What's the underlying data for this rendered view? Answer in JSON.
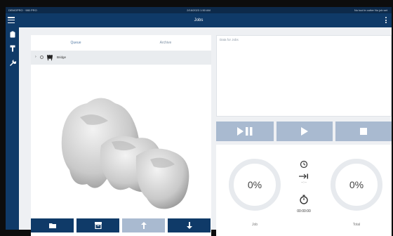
{
  "status_bar": {
    "left": "DEMOPRO · 980 PRO",
    "center": "2/16/2023 1:50 AM",
    "right": "No tool in cutter   No job set"
  },
  "app_bar": {
    "title": "Jobs"
  },
  "sidebar": {
    "icons": [
      "clipboard-icon",
      "tool-icon",
      "wrench-icon"
    ]
  },
  "tabs": [
    {
      "label": "Queue"
    },
    {
      "label": "Archive"
    }
  ],
  "job_tree": {
    "item": {
      "label": "Bridge"
    }
  },
  "job_box": {
    "placeholder": "Data for Jobs"
  },
  "progress": {
    "job": {
      "percent": "0%",
      "label": "Job"
    },
    "total": {
      "percent": "0%",
      "label": "Total"
    },
    "elapsed": "00:00:00",
    "remaining": "--:--"
  },
  "colors": {
    "primary": "#0f3a68",
    "disabled": "#a9bad0",
    "background": "#eef0f3"
  }
}
